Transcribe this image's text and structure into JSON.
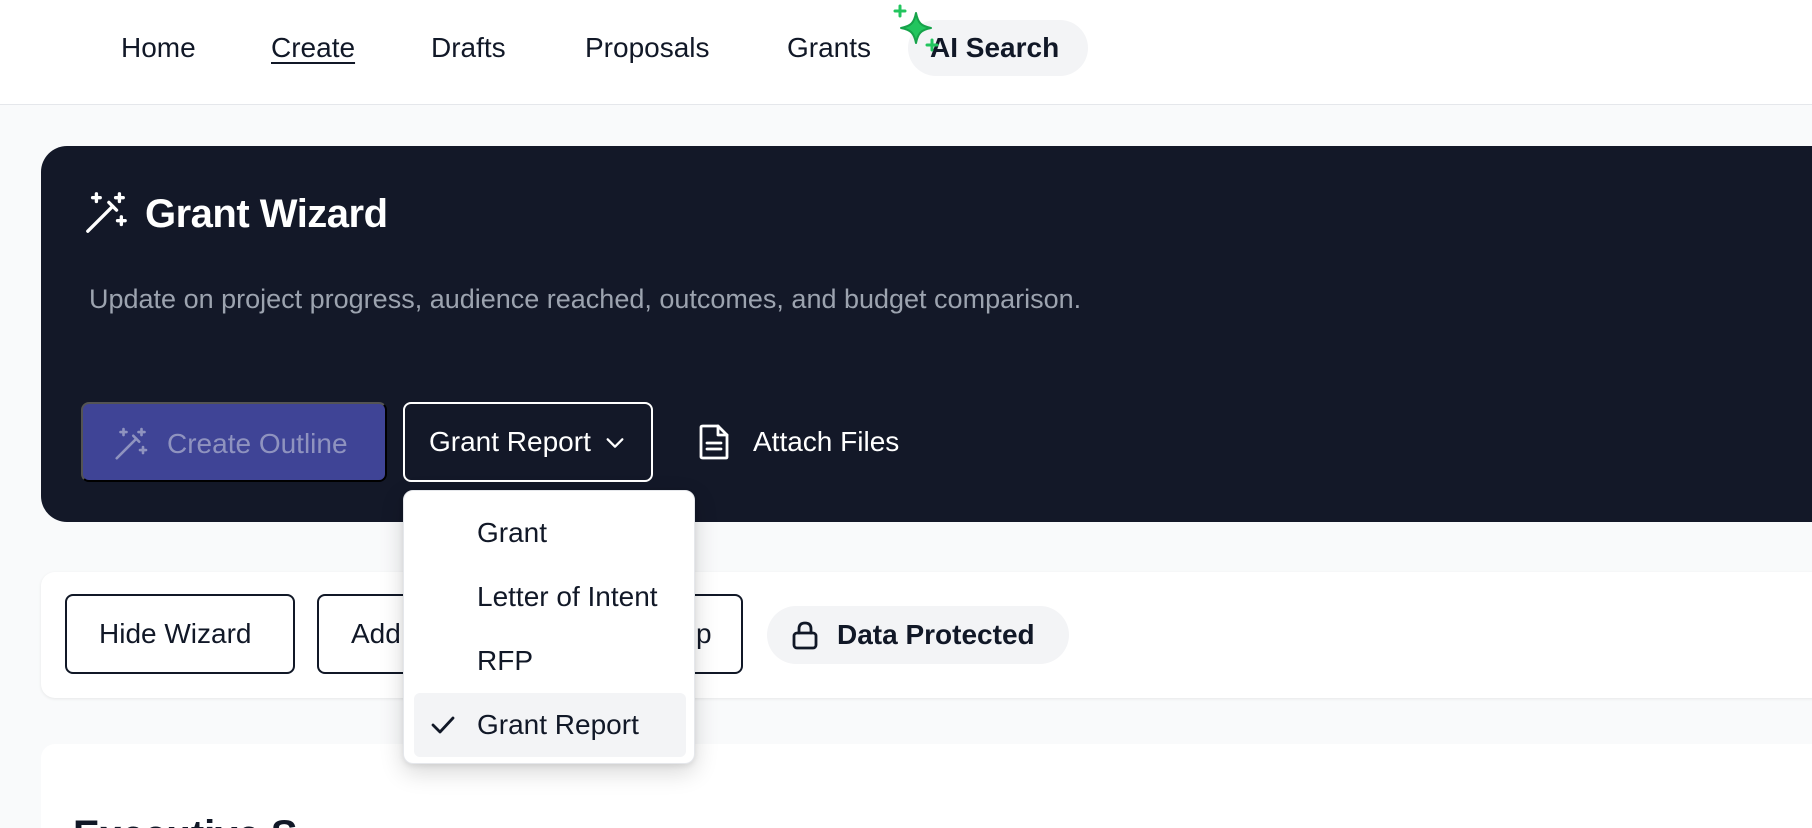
{
  "nav": {
    "items": [
      {
        "label": "Home",
        "active": false
      },
      {
        "label": "Create",
        "active": true
      },
      {
        "label": "Drafts",
        "active": false
      },
      {
        "label": "Proposals",
        "active": false
      },
      {
        "label": "Grants",
        "active": false
      }
    ],
    "ai_search_label": "AI Search"
  },
  "wizard": {
    "title": "Grant Wizard",
    "description": "Update on project progress, audience reached, outcomes, and budget comparison.",
    "create_outline_label": "Create Outline",
    "document_type_selected": "Grant Report",
    "attach_files_label": "Attach Files"
  },
  "dropdown": {
    "options": [
      {
        "label": "Grant",
        "selected": false
      },
      {
        "label": "Letter of Intent",
        "selected": false
      },
      {
        "label": "RFP",
        "selected": false
      },
      {
        "label": "Grant Report",
        "selected": true
      }
    ]
  },
  "toolbar": {
    "hide_wizard_label": "Hide Wizard",
    "second_button_label_visible_start": "Add",
    "third_button_label_visible_end": "p",
    "data_protected_label": "Data Protected"
  },
  "summary": {
    "heading_partial": "Executive S"
  },
  "colors": {
    "page_bg": "#f9fafb",
    "wizard_bg": "#131828",
    "primary_button_disabled": "#3f4496",
    "sparkle_green": "#22c55e",
    "badge_bg": "#f3f4f6"
  },
  "icons": {
    "sparkle": "sparkle-icon",
    "wand": "magic-wand-icon",
    "chevron": "chevron-down-icon",
    "document": "document-icon",
    "lock": "lock-icon",
    "check": "check-icon"
  }
}
